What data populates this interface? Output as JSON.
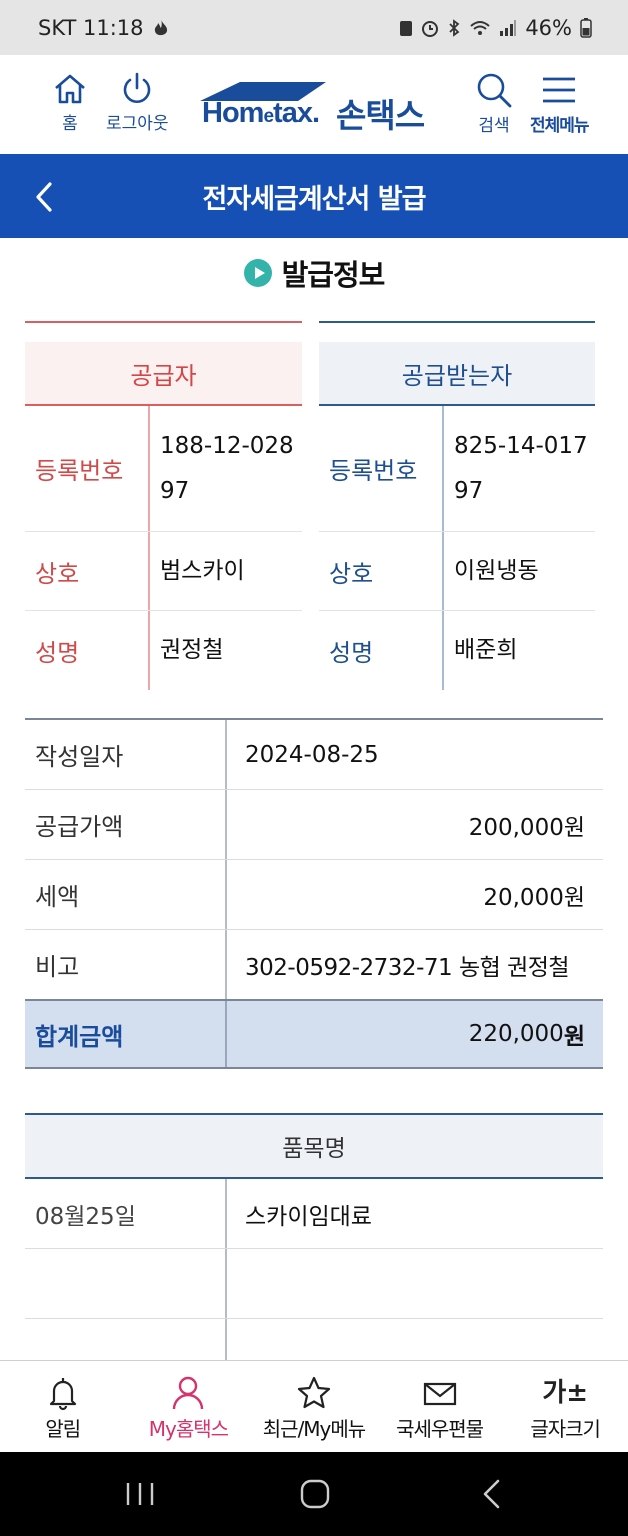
{
  "status_bar": {
    "carrier_time": "SKT 11:18",
    "battery": "46%"
  },
  "header": {
    "home_label": "홈",
    "logout_label": "로그아웃",
    "logo_home": "Hom",
    "logo_e": "e",
    "logo_tax": "tax.",
    "logo_korean": "손택스",
    "search_label": "검색",
    "menu_label": "전체메뉴"
  },
  "title_bar": {
    "title": "전자세금계산서 발급"
  },
  "section": {
    "title": "발급정보"
  },
  "supplier": {
    "heading": "공급자",
    "reg_no_label": "등록번호",
    "reg_no": "188-12-02897",
    "name_label": "상호",
    "name": "범스카이",
    "rep_label": "성명",
    "rep": "권정철"
  },
  "recipient": {
    "heading": "공급받는자",
    "reg_no_label": "등록번호",
    "reg_no": "825-14-01797",
    "name_label": "상호",
    "name": "이원냉동",
    "rep_label": "성명",
    "rep": "배준희"
  },
  "info": {
    "date_label": "작성일자",
    "date": "2024-08-25",
    "supply_label": "공급가액",
    "supply": "200,000원",
    "tax_label": "세액",
    "tax": "20,000원",
    "note_label": "비고",
    "note": "302-0592-2732-71 농협 권정철",
    "total_label": "합계금액",
    "total_amount": "220,000",
    "total_unit": "원"
  },
  "items": {
    "heading": "품목명",
    "rows": [
      {
        "date": "08월25일",
        "name": "스카이임대료"
      }
    ]
  },
  "bottom_nav": {
    "alert": "알림",
    "my": "My홈택스",
    "recent": "최근/My메뉴",
    "mail": "국세우편물",
    "font_icon": "가±",
    "font": "글자크기"
  },
  "colors": {
    "brand_blue": "#1650b5",
    "supplier_red": "#d64545",
    "recipient_navy": "#1f4f8f",
    "active_pink": "#d4336b",
    "play_teal": "#34b3aa"
  }
}
